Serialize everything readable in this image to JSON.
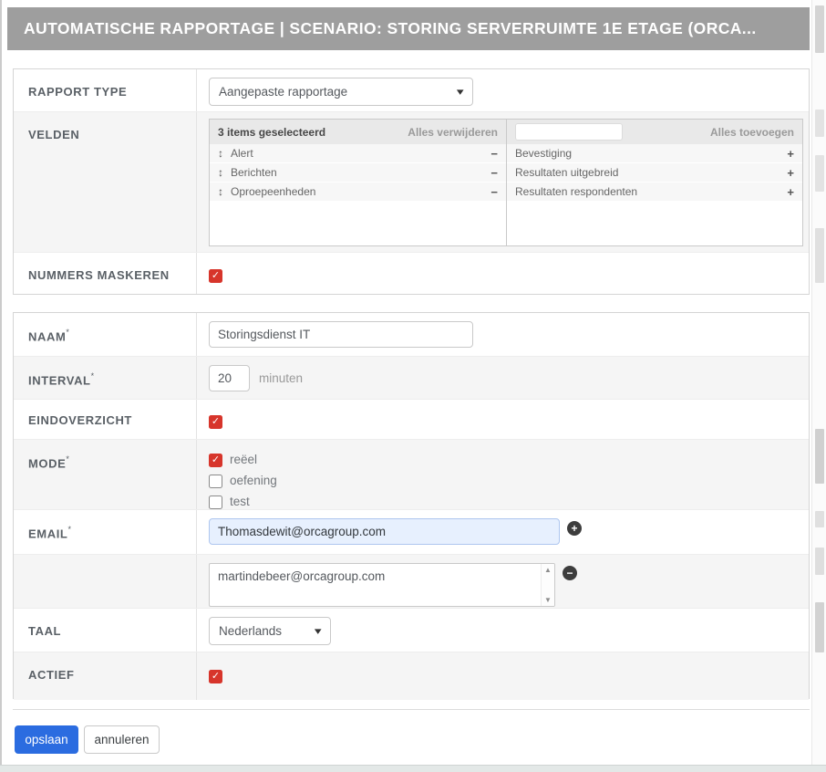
{
  "header": {
    "title": "AUTOMATISCHE RAPPORTAGE | SCENARIO: STORING SERVERRUIMTE 1E ETAGE (ORCA..."
  },
  "panel1": {
    "rapport_type": {
      "label": "RAPPORT TYPE",
      "value": "Aangepaste rapportage"
    },
    "velden": {
      "label": "VELDEN",
      "selected_header": "3 items geselecteerd",
      "remove_all_label": "Alles verwijderen",
      "add_all_label": "Alles toevoegen",
      "search_value": "",
      "selected_items": [
        "Alert",
        "Berichten",
        "Oproepeenheden"
      ],
      "available_items": [
        "Bevestiging",
        "Resultaten uitgebreid",
        "Resultaten respondenten"
      ]
    },
    "nummers_maskeren": {
      "label": "NUMMERS MASKEREN",
      "checked": true
    }
  },
  "panel2": {
    "naam": {
      "label": "NAAM",
      "required_mark": "*",
      "value": "Storingsdienst IT"
    },
    "interval": {
      "label": "INTERVAL",
      "required_mark": "*",
      "value": "20",
      "unit": "minuten"
    },
    "eindoverzicht": {
      "label": "EINDOVERZICHT",
      "checked": true
    },
    "mode": {
      "label": "MODE",
      "required_mark": "*",
      "options": [
        {
          "label": "reëel",
          "checked": true
        },
        {
          "label": "oefening",
          "checked": false
        },
        {
          "label": "test",
          "checked": false
        }
      ]
    },
    "email": {
      "label": "EMAIL",
      "required_mark": "*",
      "primary_value": "Thomasdewit@orcagroup.com",
      "secondary_value": "martindebeer@orcagroup.com"
    },
    "taal": {
      "label": "TAAL",
      "value": "Nederlands"
    },
    "actief": {
      "label": "ACTIEF",
      "checked": true
    }
  },
  "actions": {
    "save_label": "opslaan",
    "cancel_label": "annuleren"
  },
  "icons": {
    "check": "✓",
    "drag": "↕",
    "minus": "−",
    "plus": "+",
    "chevron": "▾",
    "plus_circle": "+",
    "minus_circle": "−",
    "scroll_up": "▲",
    "scroll_down": "▼"
  },
  "colors": {
    "header_bg": "#9e9e9e",
    "accent_red": "#d7352b",
    "accent_blue": "#2b6ce0",
    "row_alt_bg": "#f5f5f5",
    "autofill_bg": "#e7f0fe"
  }
}
